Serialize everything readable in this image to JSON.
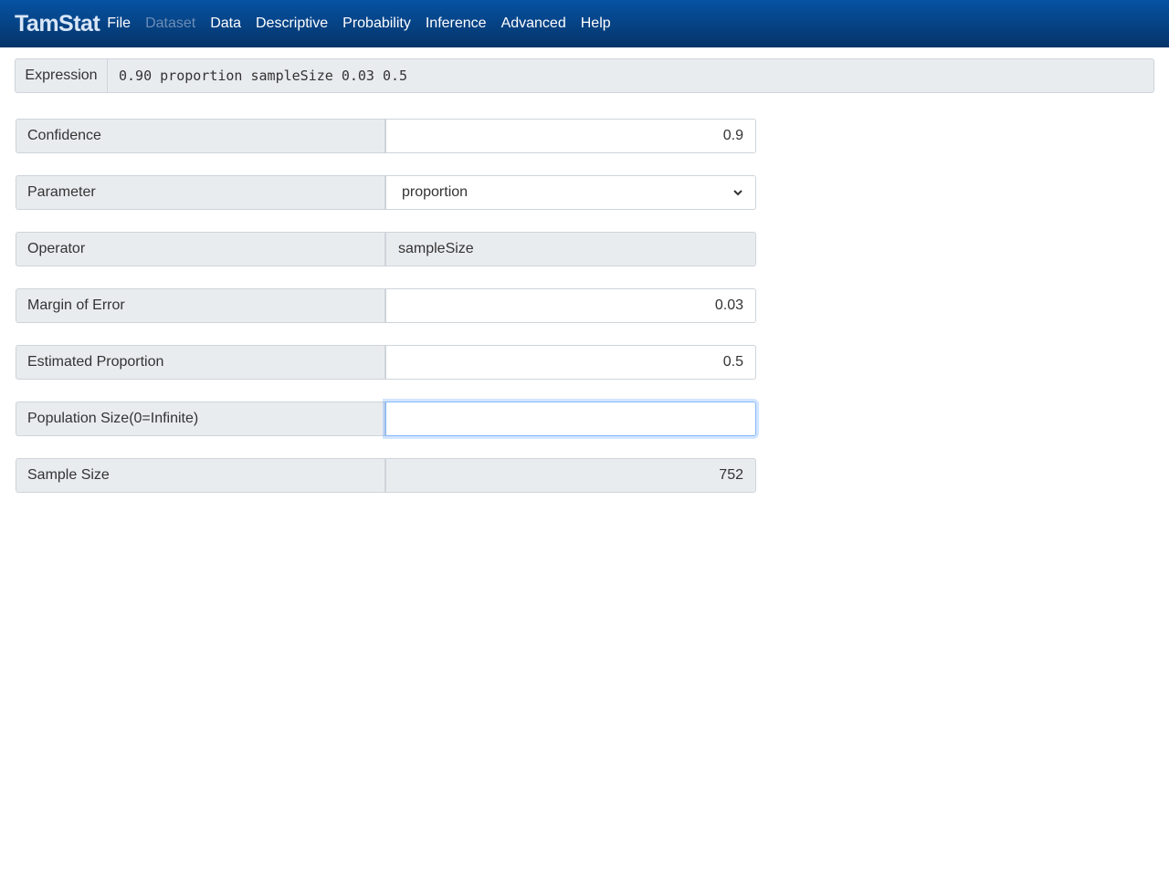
{
  "nav": {
    "brand": "TamStat",
    "items": [
      {
        "label": "File",
        "disabled": false
      },
      {
        "label": "Dataset",
        "disabled": true
      },
      {
        "label": "Data",
        "disabled": false
      },
      {
        "label": "Descriptive",
        "disabled": false
      },
      {
        "label": "Probability",
        "disabled": false
      },
      {
        "label": "Inference",
        "disabled": false
      },
      {
        "label": "Advanced",
        "disabled": false
      },
      {
        "label": "Help",
        "disabled": false
      }
    ]
  },
  "expression": {
    "label": "Expression",
    "value": "0.90 proportion sampleSize 0.03 0.5"
  },
  "form": {
    "confidence": {
      "label": "Confidence",
      "value": "0.9"
    },
    "parameter": {
      "label": "Parameter",
      "value": "proportion"
    },
    "operator": {
      "label": "Operator",
      "value": "sampleSize"
    },
    "margin": {
      "label": "Margin of Error",
      "value": "0.03"
    },
    "estimated": {
      "label": "Estimated Proportion",
      "value": "0.5"
    },
    "population": {
      "label": "Population Size(0=Infinite)",
      "value": ""
    },
    "sample": {
      "label": "Sample Size",
      "value": "752"
    }
  }
}
